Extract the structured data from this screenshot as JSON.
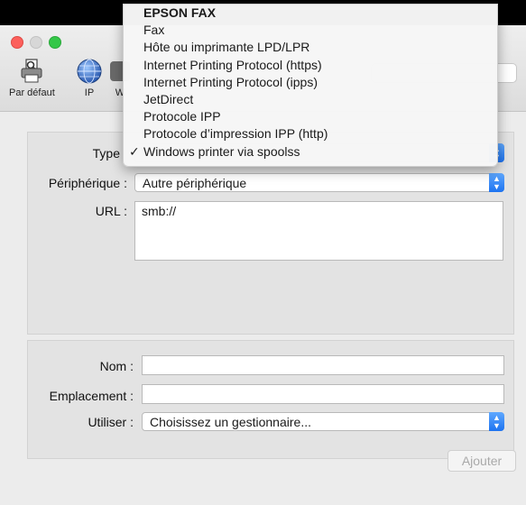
{
  "toolbar": {
    "items": [
      {
        "label": "Par défaut",
        "icon": "printer-icon"
      },
      {
        "label": "IP",
        "icon": "globe-icon"
      },
      {
        "label": "W",
        "icon": "windows-icon"
      }
    ]
  },
  "type_menu": {
    "items": [
      {
        "label": "EPSON FAX",
        "checked": false,
        "bold": true
      },
      {
        "label": "Fax",
        "checked": false
      },
      {
        "label": "Hôte ou imprimante LPD/LPR",
        "checked": false
      },
      {
        "label": "Internet Printing Protocol (https)",
        "checked": false
      },
      {
        "label": "Internet Printing Protocol (ipps)",
        "checked": false
      },
      {
        "label": "JetDirect",
        "checked": false
      },
      {
        "label": "Protocole IPP",
        "checked": false
      },
      {
        "label": "Protocole d’impression IPP (http)",
        "checked": false
      },
      {
        "label": "Windows printer via spoolss",
        "checked": true
      }
    ],
    "checkmark": "✓"
  },
  "form_top": {
    "type_label": "Type",
    "device_label": "Périphérique :",
    "device_value": "Autre périphérique",
    "url_label": "URL :",
    "url_value": "smb://"
  },
  "form_bottom": {
    "name_label": "Nom :",
    "name_value": "",
    "location_label": "Emplacement :",
    "location_value": "",
    "use_label": "Utiliser :",
    "use_value": "Choisissez un gestionnaire..."
  },
  "footer": {
    "add_button": "Ajouter"
  },
  "colors": {
    "accent": "#1d73f0",
    "close": "#fc605c",
    "zoom": "#34c748"
  }
}
